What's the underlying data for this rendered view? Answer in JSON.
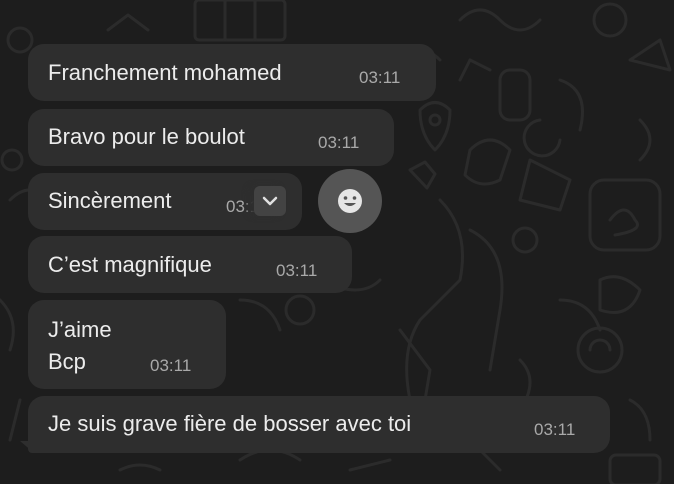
{
  "messages": [
    {
      "text": "Franchement mohamed",
      "time": "03:11"
    },
    {
      "text": "Bravo pour le boulot",
      "time": "03:11"
    },
    {
      "text": "Sincèrement",
      "time": "03:11"
    },
    {
      "text": "C’est magnifique",
      "time": "03:11"
    },
    {
      "text": "J’aime\nBcp",
      "time": "03:11"
    },
    {
      "text": "Je suis grave fière de bosser avec toi",
      "time": "03:11"
    }
  ],
  "hover_controls": {
    "menu_icon": "chevron-down-icon",
    "reaction_icon": "smiley-icon"
  },
  "colors": {
    "background": "#1d1d1d",
    "bubble": "#2e2e2e",
    "text": "#ececec",
    "time": "#a9a9a9"
  }
}
